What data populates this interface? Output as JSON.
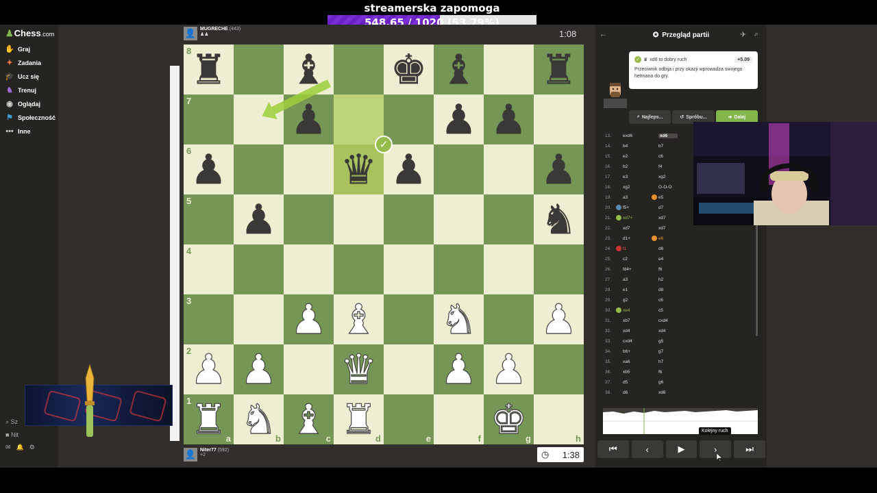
{
  "stream": {
    "donation_title": "streamerska zapomoga",
    "donation_amount": "548.65 / 1020",
    "donation_pct": "(53.79%)",
    "donation_fraction": 0.5379
  },
  "nav": {
    "logo": "Chess",
    "logo_suffix": ".com",
    "items": [
      {
        "label": "Graj",
        "icon": "play-icon",
        "color": "#81b64c"
      },
      {
        "label": "Zadania",
        "icon": "puzzle-icon",
        "color": "#f07a3c"
      },
      {
        "label": "Ucz się",
        "icon": "learn-icon",
        "color": "#3c9bd6"
      },
      {
        "label": "Trenuj",
        "icon": "train-icon",
        "color": "#9b6bd0"
      },
      {
        "label": "Oglądaj",
        "icon": "watch-icon",
        "color": "#cccccc"
      },
      {
        "label": "Społeczność",
        "icon": "community-icon",
        "color": "#3c9bd6"
      },
      {
        "label": "Inne",
        "icon": "more-icon",
        "color": "#cccccc"
      }
    ],
    "bottom": [
      "Sz",
      "Nit"
    ]
  },
  "top_player": {
    "name": "MUGRECHE",
    "rating": "(443)",
    "clock": "1:08"
  },
  "bottom_player": {
    "name": "Niter77",
    "rating": "(592)",
    "extra": "+2",
    "clock": "1:38"
  },
  "board": {
    "files": [
      "a",
      "b",
      "c",
      "d",
      "e",
      "f",
      "g",
      "h"
    ],
    "ranks": [
      "8",
      "7",
      "6",
      "5",
      "4",
      "3",
      "2",
      "1"
    ],
    "position": [
      [
        "r",
        "",
        "b",
        "",
        "k",
        "b",
        "",
        "r"
      ],
      [
        "",
        "",
        "p",
        "",
        "",
        "p",
        "p",
        ""
      ],
      [
        "p",
        "",
        "",
        "q",
        "p",
        "",
        "",
        "p"
      ],
      [
        "",
        "p",
        "",
        "",
        "",
        "",
        "",
        "n"
      ],
      [
        "",
        "",
        "",
        "",
        "",
        "",
        "",
        ""
      ],
      [
        "",
        "",
        "P",
        "B",
        "",
        "N",
        "",
        "P"
      ],
      [
        "P",
        "P",
        "",
        "Q",
        "",
        "P",
        "P",
        ""
      ],
      [
        "R",
        "N",
        "B",
        "R",
        "",
        "",
        "K",
        ""
      ]
    ],
    "highlight": [
      "d6",
      "d7"
    ],
    "best_move_square": "d6",
    "arrow": {
      "from": "c8",
      "to": "b7",
      "color": "#9ccf3a"
    }
  },
  "panel": {
    "title": "Przegląd partii",
    "comment_head": "xd6 to dobry ruch",
    "eval": "+5.09",
    "comment_body": "Przeciwnik odbija i przy okazji wprowadza swojego hetmana do gry.",
    "buttons": [
      "Najleps...",
      "Spróbu...",
      "Dalej"
    ],
    "moves": [
      {
        "n": "13.",
        "w": "exd6",
        "b": "xd6",
        "bcur": true
      },
      {
        "n": "14.",
        "w": "b4",
        "b": "b7"
      },
      {
        "n": "15.",
        "w": "e2",
        "b": "c6"
      },
      {
        "n": "16.",
        "w": "b2",
        "b": "f4"
      },
      {
        "n": "17.",
        "w": "e3",
        "b": "xg2"
      },
      {
        "n": "18.",
        "w": "xg2",
        "b": "O-O-O"
      },
      {
        "n": "19.",
        "w": "a3",
        "b": "e5",
        "btag": "orange"
      },
      {
        "n": "20.",
        "w": "f5+",
        "b": "d7",
        "wtag": "blue"
      },
      {
        "n": "21.",
        "w": "xd7+",
        "b": "xd7",
        "wtag": "green",
        "wcolor": "green"
      },
      {
        "n": "22.",
        "w": "xd7",
        "b": "xd7"
      },
      {
        "n": "23.",
        "w": "d1+",
        "b": "e6",
        "btag": "orange",
        "bcolor": "orange"
      },
      {
        "n": "24.",
        "w": "f1",
        "b": "d6",
        "wtag": "red",
        "wcolor": "red"
      },
      {
        "n": "25.",
        "w": "c2",
        "b": "e4"
      },
      {
        "n": "26.",
        "w": "fd4+",
        "b": "f6"
      },
      {
        "n": "27.",
        "w": "a3",
        "b": "h2"
      },
      {
        "n": "28.",
        "w": "e1",
        "b": "d8"
      },
      {
        "n": "29.",
        "w": "g2",
        "b": "c6"
      },
      {
        "n": "30.",
        "w": "xe4",
        "b": "c5",
        "wtag": "green",
        "wcolor": "green"
      },
      {
        "n": "31.",
        "w": "xb7",
        "b": "cxd4"
      },
      {
        "n": "32.",
        "w": "xd4",
        "b": "xd4"
      },
      {
        "n": "33.",
        "w": "cxd4",
        "b": "g5"
      },
      {
        "n": "34.",
        "w": "b6+",
        "b": "g7"
      },
      {
        "n": "35.",
        "w": "xa6",
        "b": "h7"
      },
      {
        "n": "36.",
        "w": "xb5",
        "b": "f6"
      },
      {
        "n": "37.",
        "w": "d5",
        "b": "g6"
      },
      {
        "n": "38.",
        "w": "d6",
        "b": "xd6"
      }
    ],
    "tooltip": "Kolejny ruch",
    "controls": [
      "first-move-icon",
      "prev-move-icon",
      "play-icon",
      "next-move-icon",
      "last-move-icon"
    ]
  }
}
